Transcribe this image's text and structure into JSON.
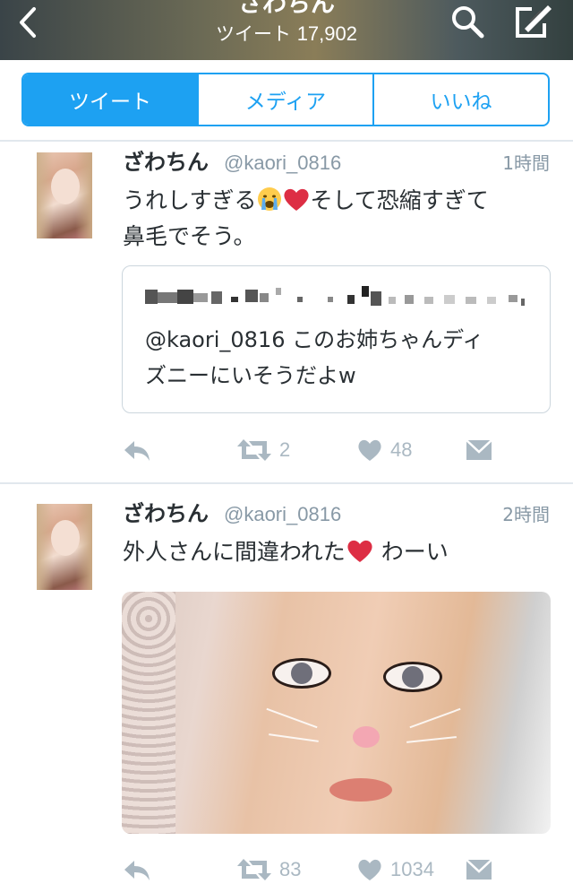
{
  "header": {
    "name": "ざわちん",
    "tweets_label": "ツイート",
    "tweets_count": "17,902",
    "back_icon": "chevron-left-icon",
    "search_icon": "search-icon",
    "compose_icon": "compose-icon"
  },
  "tabs": [
    {
      "label": "ツイート",
      "active": true
    },
    {
      "label": "メディア",
      "active": false
    },
    {
      "label": "いいね",
      "active": false
    }
  ],
  "tweets": [
    {
      "name": "ざわちん",
      "handle": "@kaori_0816",
      "time": "1時間",
      "text_part1": "うれしすぎる",
      "text_part2": "そして恐縮すぎて",
      "text_line2": "鼻毛でそう。",
      "quote": {
        "line1": "@kaori_0816 このお姉ちゃんディ",
        "line2": "ズニーにいそうだよw"
      },
      "retweets": "2",
      "likes": "48"
    },
    {
      "name": "ざわちん",
      "handle": "@kaori_0816",
      "time": "2時間",
      "text_part1": "外人さんに間違われた",
      "text_part2": "わーい",
      "retweets": "83",
      "likes": "1034"
    }
  ],
  "colors": {
    "accent": "#1da1f2",
    "muted": "#aab8c2",
    "text": "#292f33"
  }
}
